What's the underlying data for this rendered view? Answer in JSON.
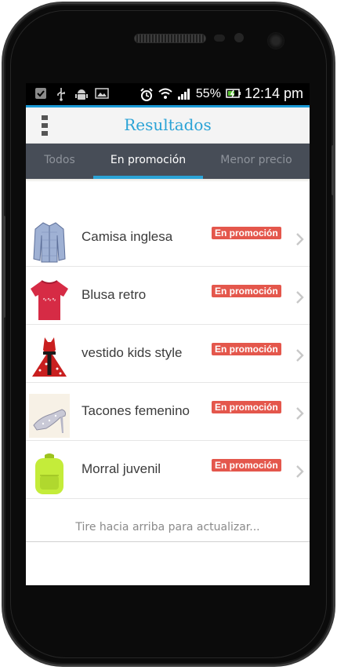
{
  "status_bar": {
    "left_icons": [
      "check-notification-icon",
      "usb-icon",
      "android-debug-icon",
      "image-icon"
    ],
    "right_icons": [
      "alarm-icon",
      "wifi-icon",
      "signal-icon",
      "battery-charging-icon"
    ],
    "battery": "55%",
    "time": "12:14 pm"
  },
  "header": {
    "title": "Resultados",
    "menu_icon": "overflow-menu-icon",
    "accent_color": "#2BA3D6"
  },
  "tabs": [
    {
      "label": "Todos",
      "active": false
    },
    {
      "label": "En promoción",
      "active": true
    },
    {
      "label": "Menor precio",
      "active": false
    }
  ],
  "products": [
    {
      "name": "Camisa inglesa",
      "badge": "En promoción",
      "image_icon": "shirt-icon"
    },
    {
      "name": "Blusa retro",
      "badge": "En promoción",
      "image_icon": "tshirt-icon"
    },
    {
      "name": "vestido kids style",
      "badge": "En promoción",
      "image_icon": "dress-icon"
    },
    {
      "name": "Tacones femenino",
      "badge": "En promoción",
      "image_icon": "high-heel-icon"
    },
    {
      "name": "Morral juvenil",
      "badge": "En promoción",
      "image_icon": "backpack-icon"
    }
  ],
  "pull_hint": "Tire hacia arriba para actualizar...",
  "colors": {
    "badge": "#E4574C",
    "tab_bar": "#474D57",
    "status_accent": "#1A9AD6"
  }
}
